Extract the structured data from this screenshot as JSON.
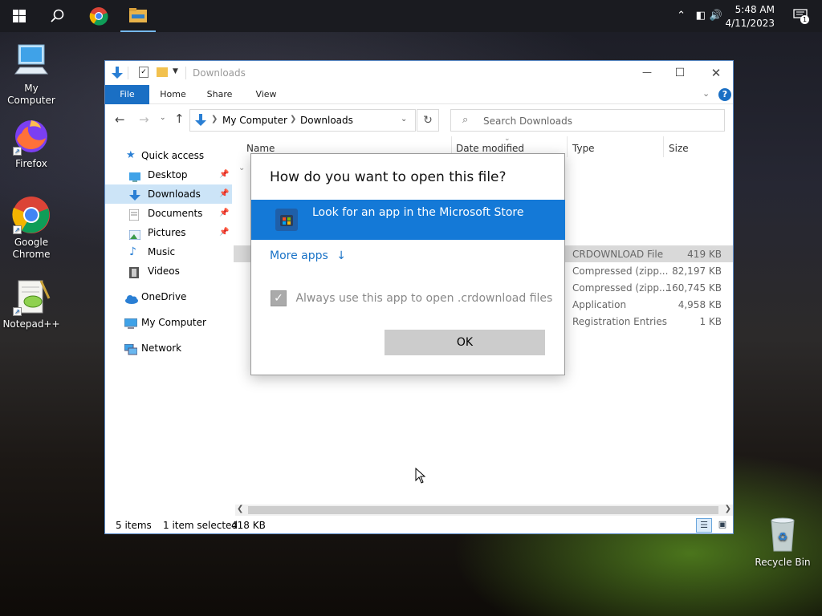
{
  "taskbar": {
    "start_icon": "windows-logo-icon",
    "search_icon": "search-icon",
    "pinned": [
      "chrome-icon",
      "file-explorer-icon"
    ],
    "clock_time": "5:48 AM",
    "clock_date": "4/11/2023",
    "notification_count": "1"
  },
  "desktop": {
    "icons": [
      {
        "label": "My Computer",
        "icon": "computer-icon"
      },
      {
        "label": "Firefox",
        "icon": "firefox-icon"
      },
      {
        "label": "Google Chrome",
        "icon": "chrome-icon"
      },
      {
        "label": "Notepad++",
        "icon": "notepadpp-icon"
      },
      {
        "label": "Recycle Bin",
        "icon": "recycle-bin-icon"
      }
    ]
  },
  "explorer": {
    "title": "Downloads",
    "ribbon_tabs": [
      "File",
      "Home",
      "Share",
      "View"
    ],
    "address": {
      "root": "My Computer",
      "current": "Downloads"
    },
    "search_placeholder": "Search Downloads",
    "nav": [
      {
        "label": "Quick access",
        "icon": "star-icon"
      },
      {
        "label": "Desktop",
        "icon": "desktop-folder-icon",
        "pinned": true
      },
      {
        "label": "Downloads",
        "icon": "download-arrow-icon",
        "pinned": true,
        "selected": true
      },
      {
        "label": "Documents",
        "icon": "documents-icon",
        "pinned": true
      },
      {
        "label": "Pictures",
        "icon": "pictures-icon",
        "pinned": true
      },
      {
        "label": "Music",
        "icon": "music-icon"
      },
      {
        "label": "Videos",
        "icon": "videos-icon"
      },
      {
        "label": "OneDrive",
        "icon": "onedrive-cloud-icon"
      },
      {
        "label": "My Computer",
        "icon": "computer-icon"
      },
      {
        "label": "Network",
        "icon": "network-icon"
      }
    ],
    "columns": [
      "Name",
      "Date modified",
      "Type",
      "Size"
    ],
    "rows": [
      {
        "type": "CRDOWNLOAD File",
        "size": "419 KB",
        "selected": true
      },
      {
        "type": "Compressed (zipp...",
        "size": "82,197 KB"
      },
      {
        "type": "Compressed (zipp...",
        "size": "160,745 KB"
      },
      {
        "type": "Application",
        "size": "4,958 KB"
      },
      {
        "type": "Registration Entries",
        "size": "1 KB"
      }
    ],
    "status": {
      "items": "5 items",
      "selected": "1 item selected",
      "size": "418 KB"
    }
  },
  "dialog": {
    "title": "How do you want to open this file?",
    "store_option": "Look for an app in the Microsoft Store",
    "more_apps": "More apps",
    "always_checkbox": "Always use this app to open .crdownload files",
    "always_checked": true,
    "ok_label": "OK"
  },
  "colors": {
    "accent": "#1479d7",
    "explorer_file_tab": "#1a6fc4",
    "selected_nav": "#cce4f7",
    "ok_button": "#cccccc"
  }
}
